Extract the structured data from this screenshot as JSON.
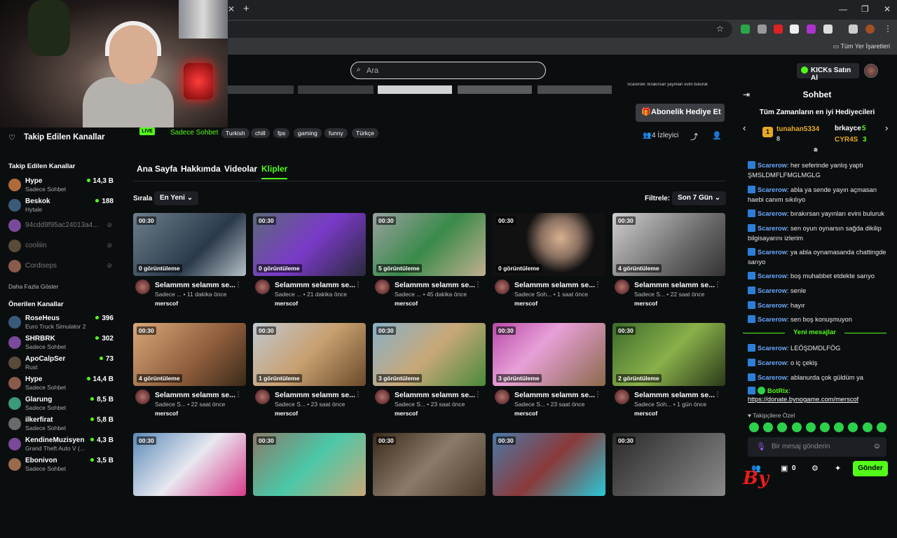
{
  "browser": {
    "bookmarks_label": "Tüm Yer İşaretleri",
    "tab_close": "✕",
    "new_tab": "+"
  },
  "header": {
    "search_placeholder": "Ara",
    "kicks_button": "KICKs Satın Al"
  },
  "stream": {
    "live_badge": "LIVE",
    "category": "Sadece Sohbet",
    "tags": [
      "Turkish",
      "chill",
      "fps",
      "gaming",
      "funny",
      "Türkçe"
    ],
    "gift_button": "Abonelik Hediye Et",
    "viewers": "4 İzleyici"
  },
  "sidebar": {
    "followed_title": "Takip Edilen Kanallar",
    "followed_header": "Takip Edilen Kanallar",
    "followed": [
      {
        "name": "Hype",
        "category": "Sadece Sohbet",
        "viewers": "14,3 B"
      },
      {
        "name": "Beskok",
        "category": "Hytale",
        "viewers": "188"
      },
      {
        "name": "94cdd9f95ac24013a4...",
        "category": "",
        "viewers": ""
      },
      {
        "name": "cooliiin",
        "category": "",
        "viewers": ""
      },
      {
        "name": "Cordiseps",
        "category": "",
        "viewers": ""
      }
    ],
    "show_more": "Daha Fazla Göster",
    "recommended_header": "Önerilen Kanallar",
    "recommended": [
      {
        "name": "RoseHeus",
        "category": "Euro Truck Simulator 2",
        "viewers": "396"
      },
      {
        "name": "SHRBRK",
        "category": "Sadece Sohbet",
        "viewers": "302"
      },
      {
        "name": "ApoCalpSer",
        "category": "Rust",
        "viewers": "73"
      },
      {
        "name": "Hype",
        "category": "Sadece Sohbet",
        "viewers": "14,4 B"
      },
      {
        "name": "Glarung",
        "category": "Sadece Sohbet",
        "viewers": "8,5 B"
      },
      {
        "name": "ilkerfirat",
        "category": "Sadece Sohbet",
        "viewers": "5,8 B"
      },
      {
        "name": "KendineMuzisyen",
        "category": "Grand Theft Auto V (...",
        "viewers": "4,3 B"
      },
      {
        "name": "Ebonivon",
        "category": "Sadece Sohbet",
        "viewers": "3,5 B"
      }
    ]
  },
  "tabs": [
    "Ana Sayfa",
    "Hakkımda",
    "Videolar",
    "Klipler"
  ],
  "filters": {
    "sort_label": "Sırala",
    "sort_value": "En Yeni",
    "filter_label": "Filtrele:",
    "filter_value": "Son 7 Gün"
  },
  "clips": [
    {
      "dur": "00:30",
      "views": "0 görüntüleme",
      "title": "Selammm selamm se...",
      "sub": "Sadece ... • 11 dakika önce",
      "author": "merscof"
    },
    {
      "dur": "00:30",
      "views": "0 görüntüleme",
      "title": "Selammm selamm se...",
      "sub": "Sadece ... • 21 dakika önce",
      "author": "merscof"
    },
    {
      "dur": "00:30",
      "views": "5 görüntüleme",
      "title": "Selammm selamm se...",
      "sub": "Sadece ... • 45 dakika önce",
      "author": "merscof"
    },
    {
      "dur": "00:30",
      "views": "0 görüntüleme",
      "title": "Selammm selamm se...",
      "sub": "Sadece Soh... • 1 saat önce",
      "author": "merscof"
    },
    {
      "dur": "00:30",
      "views": "4 görüntüleme",
      "title": "Selammm selamm se...",
      "sub": "Sadece S... • 22 saat önce",
      "author": "merscof"
    },
    {
      "dur": "00:30",
      "views": "4 görüntüleme",
      "title": "Selammm selamm se...",
      "sub": "Sadece S... • 22 saat önce",
      "author": "merscof"
    },
    {
      "dur": "00:30",
      "views": "1 görüntüleme",
      "title": "Selammm selamm se...",
      "sub": "Sadece S... • 23 saat önce",
      "author": "merscof"
    },
    {
      "dur": "00:30",
      "views": "3 görüntüleme",
      "title": "Selammm selamm se...",
      "sub": "Sadece S... • 23 saat önce",
      "author": "merscof"
    },
    {
      "dur": "00:30",
      "views": "3 görüntüleme",
      "title": "Selammm selamm se...",
      "sub": "Sadece S... • 23 saat önce",
      "author": "merscof"
    },
    {
      "dur": "00:30",
      "views": "2 görüntüleme",
      "title": "Selammm selamm se...",
      "sub": "Sadece Soh... • 1 gün önce",
      "author": "merscof"
    },
    {
      "dur": "00:30"
    },
    {
      "dur": "00:30"
    },
    {
      "dur": "00:30"
    },
    {
      "dur": "00:30"
    },
    {
      "dur": "00:30"
    }
  ],
  "chat": {
    "title": "Sohbet",
    "top_gifters": "Tüm Zamanların en iyi Hediyecileri",
    "gifters": [
      {
        "rank": "1",
        "name": "tunahan5334",
        "count": "8"
      },
      {
        "name": "brkayce",
        "count": "5"
      },
      {
        "name": "CYR4S",
        "count": "3"
      }
    ],
    "messages": [
      {
        "user": "Scarerow",
        "text": ": her seferinde yanlış yaptı ŞMSLDMFLFMGLMGLG"
      },
      {
        "user": "Scarerow",
        "text": ": abla ya sende yayın açmasan haebi canım sıkılıyo"
      },
      {
        "user": "Scarerow",
        "text": ": bırakırsan yayınları evini buluruk"
      },
      {
        "user": "Scarerow",
        "text": ": sen oyun oynarsın sağda dikilip bilgisayarını izlerim"
      },
      {
        "user": "Scarerow",
        "text": ": ya abla oynamasanda chattingde sarıyo"
      },
      {
        "user": "Scarerow",
        "text": ": boş muhabbet etdekte sarıyo"
      },
      {
        "user": "Scarerow",
        "text": ": senle"
      },
      {
        "user": "Scarerow",
        "text": ": hayır"
      },
      {
        "user": "Scarerow",
        "text": ": sen boş konuşmuyon"
      }
    ],
    "new_messages": "Yeni mesajlar",
    "new": [
      {
        "user": "Scarerow",
        "text": ": LEÖŞDMDLFÖG"
      },
      {
        "user": "Scarerow",
        "text": ": o iç çekiş"
      },
      {
        "user": "Scarerow",
        "text": ": ablanurda çok güldüm ya"
      },
      {
        "user": "BotRix",
        "text": ":"
      }
    ],
    "link": "https://donate.bynogame.com/merscof",
    "follower_only": "Takipçilere Özel",
    "input_placeholder": "Bir mesaj gönderin",
    "kick_count": "0",
    "send": "Gönder",
    "top_strip_text": "Scarerow: bırakırsan yayınları evini buluruk"
  },
  "brand": "By",
  "colors": {
    "accent": "#53fc18",
    "bg": "#0b0e0f",
    "chat_user": "#6aa8ff"
  }
}
